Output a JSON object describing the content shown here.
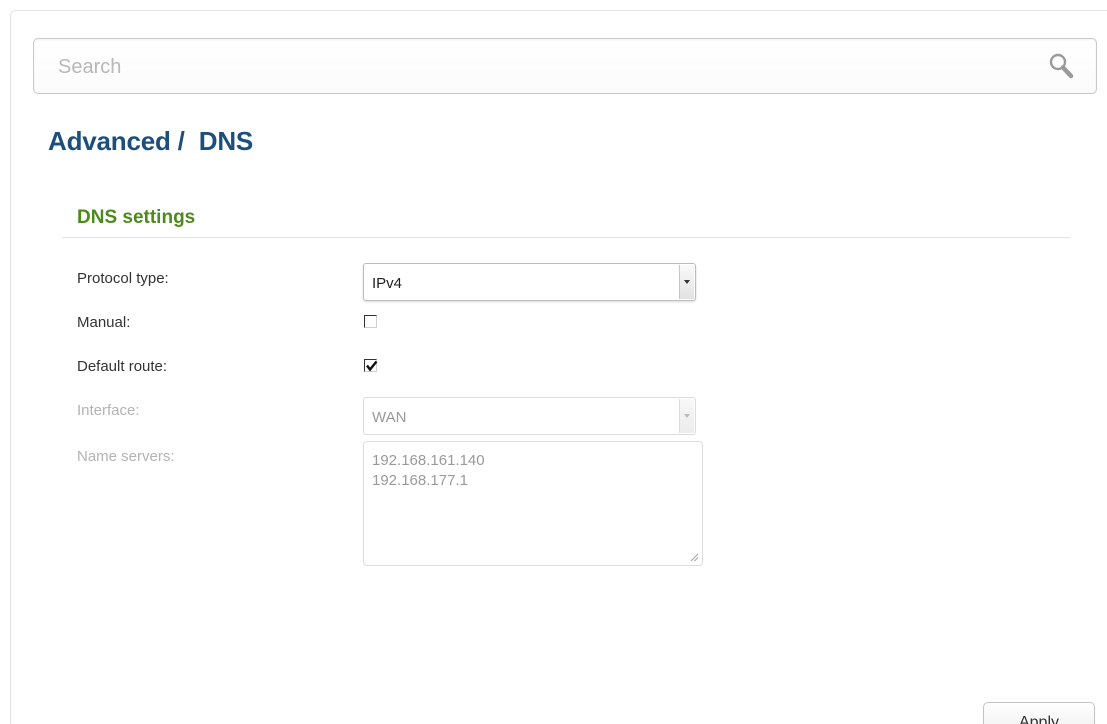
{
  "search": {
    "placeholder": "Search",
    "icon": "search-icon"
  },
  "header": {
    "title": "Advanced /  DNS"
  },
  "section": {
    "title": "DNS settings"
  },
  "form": {
    "protocol_type": {
      "label": "Protocol type:",
      "value": "IPv4"
    },
    "manual": {
      "label": "Manual:",
      "checked": false
    },
    "default_route": {
      "label": "Default route:",
      "checked": true
    },
    "interface": {
      "label": "Interface:",
      "value": "WAN",
      "disabled": true
    },
    "name_servers": {
      "label": "Name servers:",
      "lines": [
        "192.168.161.140",
        "192.168.177.1"
      ],
      "disabled": true
    }
  },
  "actions": {
    "apply_label": "Apply"
  },
  "colors": {
    "title": "#1d4f7c",
    "section_title": "#4c8a1c",
    "disabled_text": "#b3b3b3"
  }
}
